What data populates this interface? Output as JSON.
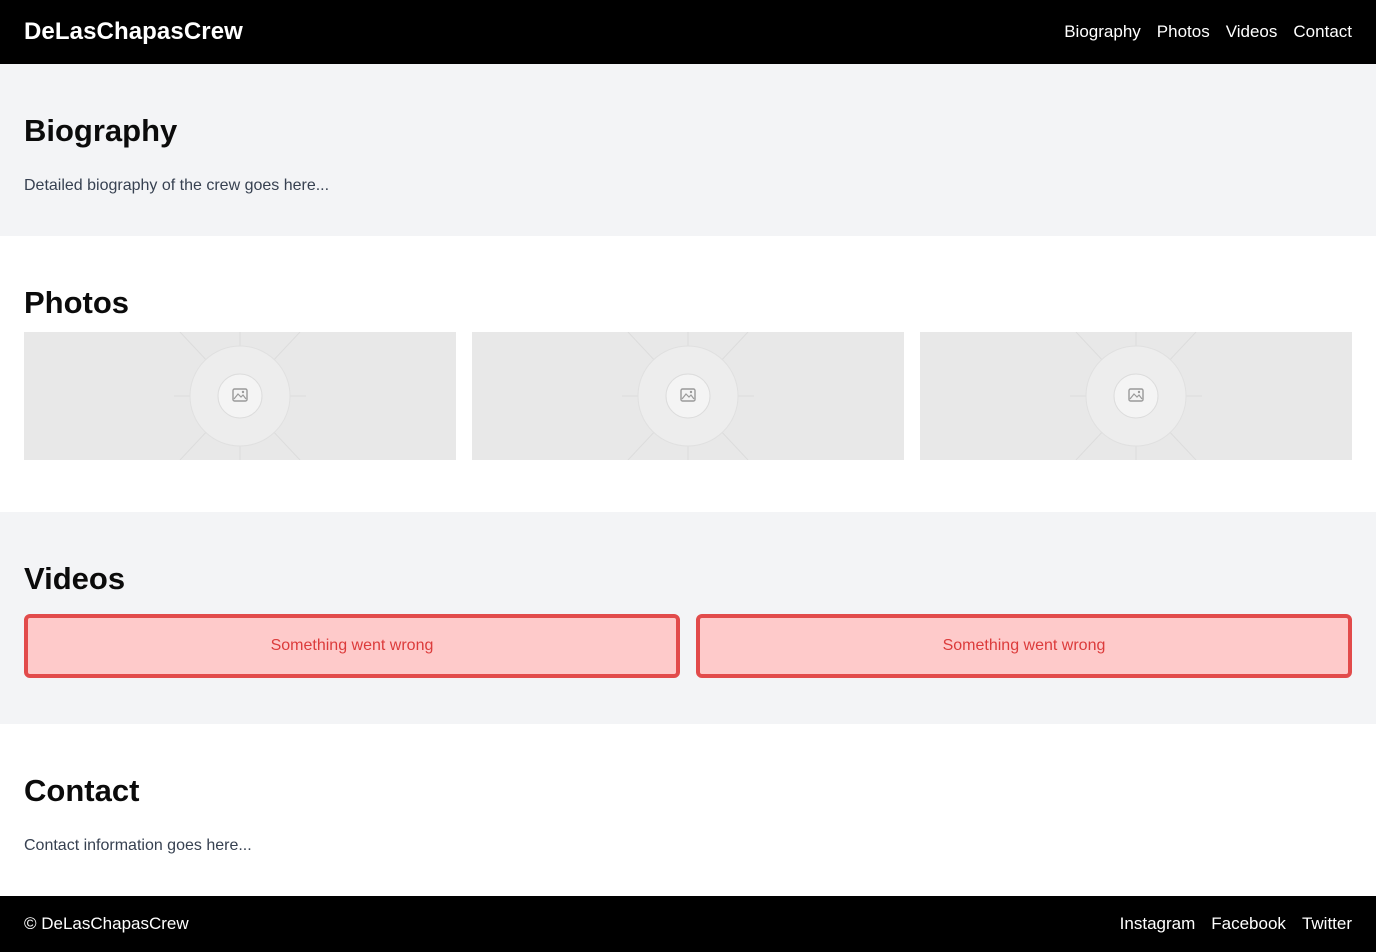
{
  "header": {
    "brand": "DeLasChapasCrew",
    "nav": [
      {
        "label": "Biography"
      },
      {
        "label": "Photos"
      },
      {
        "label": "Videos"
      },
      {
        "label": "Contact"
      }
    ]
  },
  "biography": {
    "title": "Biography",
    "text": "Detailed biography of the crew goes here..."
  },
  "photos": {
    "title": "Photos",
    "items": [
      {
        "icon": "image-placeholder-icon"
      },
      {
        "icon": "image-placeholder-icon"
      },
      {
        "icon": "image-placeholder-icon"
      }
    ]
  },
  "videos": {
    "title": "Videos",
    "items": [
      {
        "error": "Something went wrong"
      },
      {
        "error": "Something went wrong"
      }
    ]
  },
  "contact": {
    "title": "Contact",
    "text": "Contact information goes here..."
  },
  "footer": {
    "copyright": "© DeLasChapasCrew",
    "links": [
      {
        "label": "Instagram"
      },
      {
        "label": "Facebook"
      },
      {
        "label": "Twitter"
      }
    ]
  },
  "colors": {
    "header_bg": "#000000",
    "section_alt_bg": "#f3f4f6",
    "error_border": "#e24b4b",
    "error_bg": "#fecaca",
    "error_text": "#dc3b3b"
  }
}
